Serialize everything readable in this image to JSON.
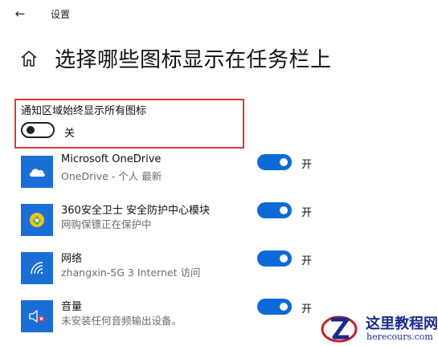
{
  "window": {
    "title": "设置"
  },
  "page": {
    "title": "选择哪些图标显示在任务栏上"
  },
  "always_show": {
    "label": "通知区域始终显示所有图标",
    "state_label": "关",
    "on": false
  },
  "apps": [
    {
      "name": "Microsoft OneDrive",
      "status": "OneDrive - 个人 最新",
      "state_label": "开",
      "icon": "onedrive-icon"
    },
    {
      "name": "360安全卫士 安全防护中心模块",
      "status": "网购保镖正在保护中",
      "state_label": "开",
      "icon": "shield-360-icon"
    },
    {
      "name": "网络",
      "status": "zhangxin-5G 3 Internet 访问",
      "state_label": "开",
      "icon": "wifi-icon"
    },
    {
      "name": "音量",
      "status": "未安装任何音频输出设备。",
      "state_label": "开",
      "icon": "speaker-muted-icon"
    }
  ],
  "watermark": {
    "title": "这里教程网",
    "url": "herecours.com"
  },
  "colors": {
    "accent": "#0b6ad6",
    "highlight_border": "#e0383b",
    "app_icon_bg": "#1a6fd6",
    "watermark": "#1a2a8c"
  }
}
